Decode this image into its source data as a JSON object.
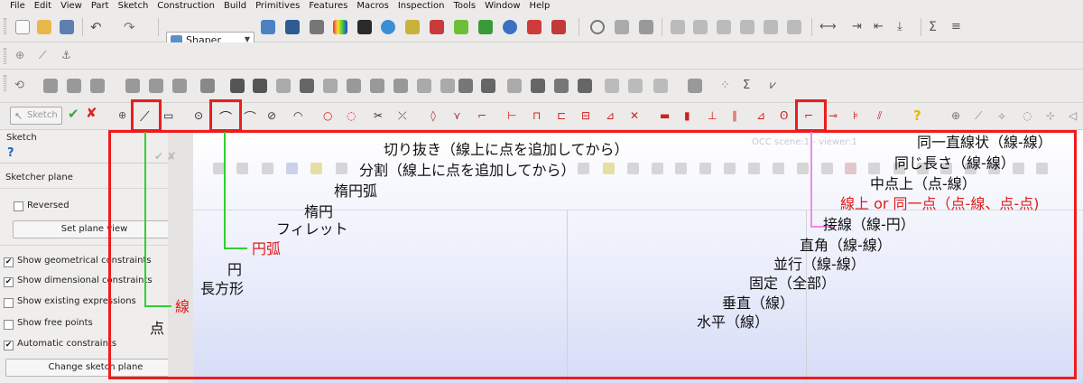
{
  "menu": [
    "File",
    "Edit",
    "View",
    "Part",
    "Sketch",
    "Construction",
    "Build",
    "Primitives",
    "Features",
    "Macros",
    "Inspection",
    "Tools",
    "Window",
    "Help"
  ],
  "workbench": {
    "label": "Shaper"
  },
  "sketch_toolbar": {
    "sketch_label": "Sketch"
  },
  "panel": {
    "title": "Sketch",
    "section": "Sketcher plane",
    "reversed_label": "Reversed",
    "set_plane_label": "Set plane view",
    "options": [
      {
        "label": "Show geometrical constraints",
        "checked": true
      },
      {
        "label": "Show dimensional constraints",
        "checked": true
      },
      {
        "label": "Show existing expressions",
        "checked": false
      },
      {
        "label": "Show free points",
        "checked": false
      },
      {
        "label": "Automatic constraints",
        "checked": true
      }
    ],
    "change_plane_label": "Change sketch plane"
  },
  "viewport": {
    "scene_label": "OCC scene:1 - viewer:1"
  },
  "annotations": {
    "trim": "切り抜き（線上に点を追加してから）",
    "split": "分割（線上に点を追加してから）",
    "ellipse_arc": "楕円弧",
    "ellipse": "楕円",
    "fillet": "フィレット",
    "arc": "円弧",
    "circle": "円",
    "rectangle": "長方形",
    "line": "線",
    "point": "点",
    "collinear": "同一直線状（線-線）",
    "equal_length": "同じ長さ（線-線）",
    "midpoint": "中点上（点-線）",
    "coincident": "線上 or 同一点（点-線、点-点)",
    "tangent": "接線（線-円）",
    "perpendicular": "直角（線-線）",
    "parallel": "並行（線-線）",
    "fixed": "固定（全部）",
    "vertical": "垂直（線）",
    "horizontal": "水平（線）"
  },
  "colors": {
    "highlight": "#ee1c1c",
    "connector_green": "#2ed12e",
    "connector_pink": "#f08ae8",
    "accent_red_text": "#e01b1b"
  }
}
